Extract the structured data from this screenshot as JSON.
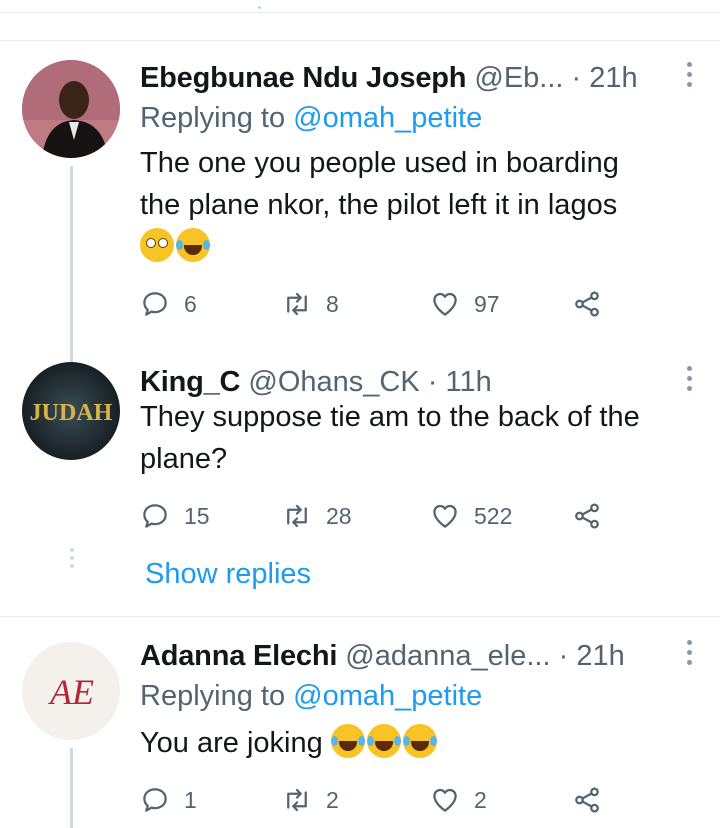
{
  "tweets": [
    {
      "name": "Ebegbunae Ndu Joseph",
      "handle": "@Eb...",
      "time": "21h",
      "reply_prefix": "Replying to ",
      "reply_to": "@omah_petite",
      "text_lines": [
        "The one you people used in boarding",
        "the plane nkor, the pilot left it in lagos"
      ],
      "emoji_icons": [
        "face-with-rolling-eyes-icon",
        "rolling-on-floor-laughing-icon"
      ],
      "stats": {
        "replies": "6",
        "retweets": "8",
        "likes": "97"
      }
    },
    {
      "name": "King_C",
      "handle": "@Ohans_CK",
      "time": "11h",
      "avatar_text": "JUDAH",
      "text_lines": [
        "They suppose tie am to the back of the",
        "plane?"
      ],
      "stats": {
        "replies": "15",
        "retweets": "28",
        "likes": "522"
      },
      "show_replies": "Show replies"
    },
    {
      "name": "Adanna Elechi",
      "handle": "@adanna_ele...",
      "time": "21h",
      "avatar_text": "AE",
      "reply_prefix": "Replying to ",
      "reply_to": "@omah_petite",
      "text_lines": [
        "You are joking"
      ],
      "emoji_icons": [
        "face-with-tears-of-joy-icon",
        "face-with-tears-of-joy-icon",
        "face-with-tears-of-joy-icon"
      ],
      "stats": {
        "replies": "1",
        "retweets": "2",
        "likes": "2"
      }
    }
  ],
  "separator": "·",
  "colors": {
    "accent": "#1d9bf0",
    "muted": "#536471",
    "text": "#14171a",
    "divider": "#e6ecf0"
  }
}
